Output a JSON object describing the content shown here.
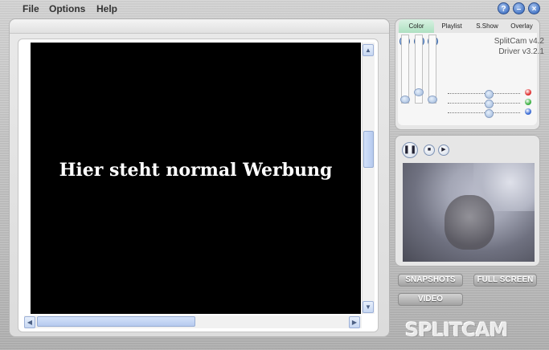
{
  "menu": {
    "file": "File",
    "options": "Options",
    "help": "Help"
  },
  "window_buttons": {
    "help": "?",
    "minimize": "–",
    "close": "×"
  },
  "video": {
    "overlay_text": "Hier steht normal Werbung"
  },
  "tabs": [
    {
      "label": "Color",
      "active": true
    },
    {
      "label": "Playlist",
      "active": false
    },
    {
      "label": "S.Show",
      "active": false
    },
    {
      "label": "Overlay",
      "active": false
    }
  ],
  "version": {
    "app": "SplitCam v4.2",
    "driver": "Driver v3.2.1"
  },
  "color_dots": [
    "#e03030",
    "#3cb043",
    "#3a6bd4"
  ],
  "buttons": {
    "snapshots": "SNAPSHOTS",
    "full_screen": "FULL SCREEN",
    "video": "VIDEO"
  },
  "logo": "SPLITCAM"
}
